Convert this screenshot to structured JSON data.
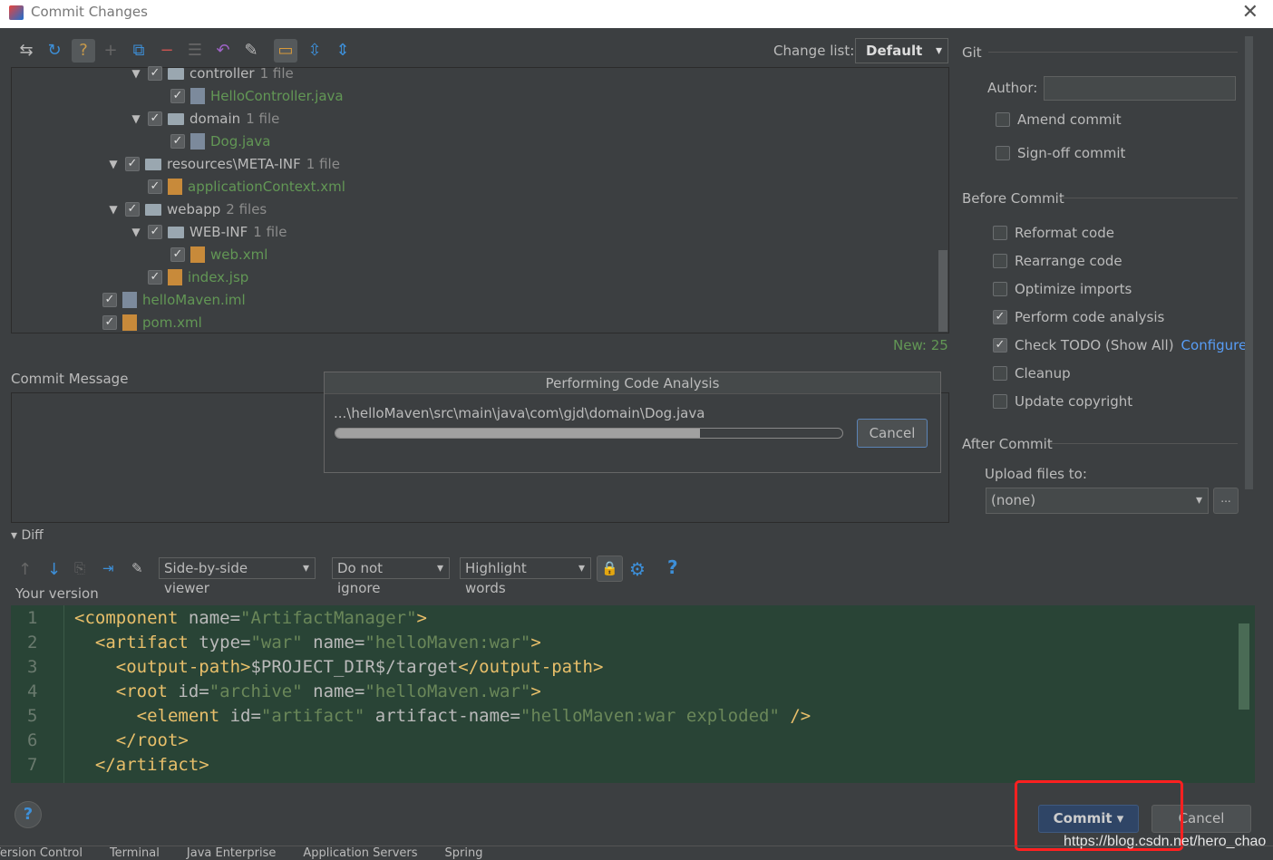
{
  "window": {
    "title": "Commit Changes",
    "close": "✕"
  },
  "toolbar": {
    "icons": [
      "refresh-changes-icon",
      "rollback-icon",
      "unversioned-icon",
      "add-icon",
      "move-to-changelist-icon",
      "remove-icon",
      "group-icon",
      "revert-icon",
      "edit-source-icon",
      "show-directories-icon",
      "expand-all-icon",
      "collapse-all-icon"
    ],
    "changelist_label": "Change list:",
    "changelist_value": "Default"
  },
  "tree": [
    {
      "indent": 4,
      "expand": true,
      "name": "controller",
      "count": "1 file",
      "type": "folder"
    },
    {
      "indent": 5,
      "name": "HelloController.java",
      "type": "java"
    },
    {
      "indent": 4,
      "expand": true,
      "name": "domain",
      "count": "1 file",
      "type": "folder"
    },
    {
      "indent": 5,
      "name": "Dog.java",
      "type": "java"
    },
    {
      "indent": 3,
      "expand": true,
      "name": "resources\\META-INF",
      "count": "1 file",
      "type": "folder"
    },
    {
      "indent": 4,
      "name": "applicationContext.xml",
      "type": "xml"
    },
    {
      "indent": 3,
      "expand": true,
      "name": "webapp",
      "count": "2 files",
      "type": "folder"
    },
    {
      "indent": 4,
      "expand": true,
      "name": "WEB-INF",
      "count": "1 file",
      "type": "folder"
    },
    {
      "indent": 5,
      "name": "web.xml",
      "type": "xml"
    },
    {
      "indent": 4,
      "name": "index.jsp",
      "type": "jsp"
    },
    {
      "indent": 2,
      "name": "helloMaven.iml",
      "type": "iml"
    },
    {
      "indent": 2,
      "name": "pom.xml",
      "type": "xml"
    }
  ],
  "new_count": "New: 25",
  "commit_message": {
    "label": "Commit Message"
  },
  "progress": {
    "title": "Performing Code Analysis",
    "path": "...\\helloMaven\\src\\main\\java\\com\\gjd\\domain\\Dog.java",
    "percent": 72,
    "cancel": "Cancel"
  },
  "git": {
    "header": "Git",
    "author_label": "Author:",
    "author_value": "",
    "amend": "Amend commit",
    "signoff": "Sign-off commit"
  },
  "before_commit": {
    "header": "Before Commit",
    "options": [
      {
        "label": "Reformat code",
        "checked": false
      },
      {
        "label": "Rearrange code",
        "checked": false
      },
      {
        "label": "Optimize imports",
        "checked": false
      },
      {
        "label": "Perform code analysis",
        "checked": true
      },
      {
        "label": "Check TODO (Show All)",
        "checked": true,
        "link": "Configure"
      },
      {
        "label": "Cleanup",
        "checked": false
      },
      {
        "label": "Update copyright",
        "checked": false
      }
    ]
  },
  "after_commit": {
    "header": "After Commit",
    "upload_label": "Upload files to:",
    "upload_value": "(none)",
    "more": "..."
  },
  "diff": {
    "label": "Diff",
    "viewer": "Side-by-side viewer",
    "ignore": "Do not ignore",
    "highlight": "Highlight words",
    "help": "?",
    "version_label": "Your version"
  },
  "code": [
    [
      "1",
      [
        [
          "t",
          "<component "
        ],
        [
          "a",
          "name="
        ],
        [
          "v",
          "\"ArtifactManager\""
        ],
        [
          "t",
          ">"
        ]
      ]
    ],
    [
      "2",
      [
        [
          "s",
          "  "
        ],
        [
          "t",
          "<artifact "
        ],
        [
          "a",
          "type="
        ],
        [
          "v",
          "\"war\""
        ],
        [
          "a",
          " name="
        ],
        [
          "v",
          "\"helloMaven:war\""
        ],
        [
          "t",
          ">"
        ]
      ]
    ],
    [
      "3",
      [
        [
          "s",
          "    "
        ],
        [
          "t",
          "<output-path>"
        ],
        [
          "a",
          "$PROJECT_DIR$/target"
        ],
        [
          "t",
          "</output-path>"
        ]
      ]
    ],
    [
      "4",
      [
        [
          "s",
          "    "
        ],
        [
          "t",
          "<root "
        ],
        [
          "a",
          "id="
        ],
        [
          "v",
          "\"archive\""
        ],
        [
          "a",
          " name="
        ],
        [
          "v",
          "\"helloMaven.war\""
        ],
        [
          "t",
          ">"
        ]
      ]
    ],
    [
      "5",
      [
        [
          "s",
          "      "
        ],
        [
          "t",
          "<element "
        ],
        [
          "a",
          "id="
        ],
        [
          "v",
          "\"artifact\""
        ],
        [
          "a",
          " artifact-name="
        ],
        [
          "v",
          "\"helloMaven:war exploded\""
        ],
        [
          "t",
          " />"
        ]
      ]
    ],
    [
      "6",
      [
        [
          "s",
          "    "
        ],
        [
          "t",
          "</root>"
        ]
      ]
    ],
    [
      "7",
      [
        [
          "s",
          "  "
        ],
        [
          "t",
          "</artifact>"
        ]
      ]
    ]
  ],
  "buttons": {
    "help": "?",
    "commit": "Commit",
    "cancel": "Cancel"
  },
  "watermark": "https://blog.csdn.net/hero_chao",
  "bottom_tabs": [
    "Version Control",
    "Terminal",
    "Java Enterprise",
    "Application Servers",
    "Spring"
  ],
  "colors": {
    "bg": "#3c3f41",
    "new_file": "#629755",
    "diff_bg": "#294436",
    "highlight": "#ff2020",
    "link": "#589df6"
  }
}
